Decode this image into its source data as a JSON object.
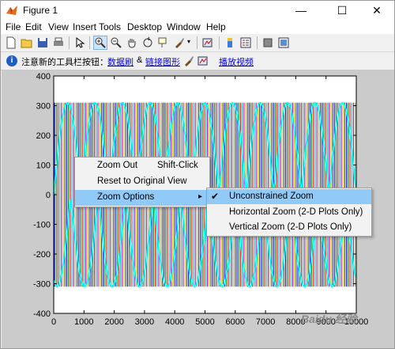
{
  "window": {
    "title": "Figure 1"
  },
  "menubar": {
    "items": [
      "File",
      "Edit",
      "View",
      "Insert",
      "Tools",
      "Desktop",
      "Window",
      "Help"
    ]
  },
  "infobar": {
    "text": "注意新的工具栏按钮：",
    "link1": "数据刷",
    "sep": "&",
    "link2": "链接图形",
    "link3": "播放视频"
  },
  "context_menu": {
    "items": [
      {
        "label": "Zoom Out",
        "shortcut": "Shift-Click"
      },
      {
        "label": "Reset to Original View",
        "shortcut": ""
      },
      {
        "label": "Zoom Options",
        "shortcut": "",
        "submenu": true
      }
    ]
  },
  "submenu": {
    "items": [
      {
        "label": "Unconstrained Zoom",
        "checked": true
      },
      {
        "label": "Horizontal Zoom (2-D Plots Only)",
        "checked": false
      },
      {
        "label": "Vertical Zoom (2-D Plots Only)",
        "checked": false
      }
    ]
  },
  "watermark": "Baidu 经验",
  "chart_data": {
    "type": "line",
    "title": "",
    "xlabel": "",
    "ylabel": "",
    "xlim": [
      0,
      10000
    ],
    "ylim": [
      -400,
      400
    ],
    "xticks": [
      0,
      1000,
      2000,
      3000,
      4000,
      5000,
      6000,
      7000,
      8000,
      9000,
      10000
    ],
    "yticks": [
      400,
      300,
      200,
      100,
      0,
      -100,
      -200,
      -300,
      -400
    ],
    "amplitude": 310,
    "series_colors": [
      "#0000ff",
      "#008000",
      "#ff0000",
      "#00bfbf",
      "#bf00bf",
      "#bfbf00",
      "#404040"
    ],
    "envelope_color": "#00ffff"
  },
  "colors": {
    "highlight": "#91c9f7",
    "link": "#0000ee"
  }
}
